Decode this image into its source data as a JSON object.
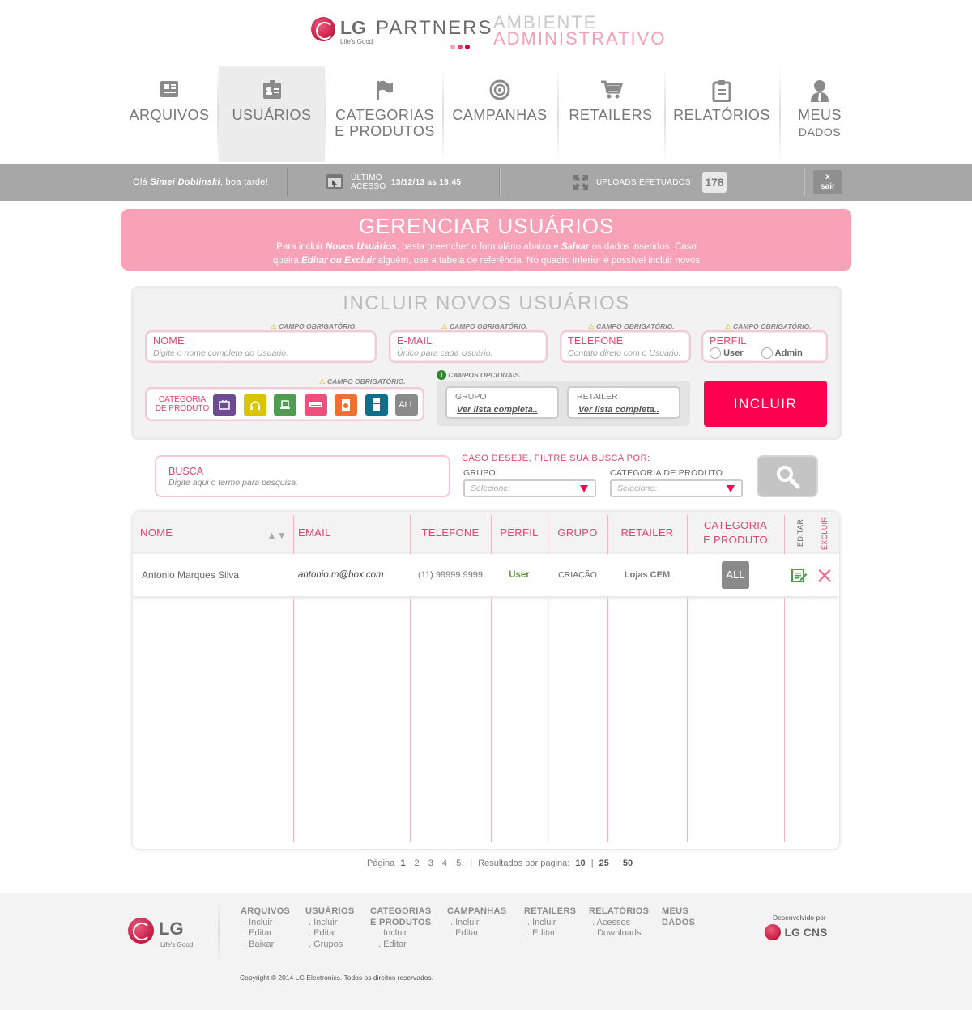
{
  "header": {
    "brand": "LG",
    "tagline": "Life's Good",
    "product": "PARTNERS",
    "env_line1": "AMBIENTE",
    "env_line2": "ADMINISTRATIVO"
  },
  "nav": {
    "items": [
      {
        "label": "ARQUIVOS",
        "icon": "newspaper-icon"
      },
      {
        "label": "USUÁRIOS",
        "icon": "id-card-icon",
        "active": true
      },
      {
        "label": "CATEGORIAS",
        "label2": "E PRODUTOS",
        "icon": "flag-icon"
      },
      {
        "label": "CAMPANHAS",
        "icon": "target-icon"
      },
      {
        "label": "RETAILERS",
        "icon": "cart-icon"
      },
      {
        "label": "RELATÓRIOS",
        "icon": "clipboard-icon"
      },
      {
        "label": "MEUS",
        "label2": "DADOS",
        "icon": "user-icon"
      }
    ]
  },
  "status": {
    "greeting_prefix": "Olá",
    "user_name": "Simei Doblinski",
    "greeting_suffix": ", boa tarde!",
    "last_access_label1": "ÚLTIMO",
    "last_access_label2": "ACESSO",
    "last_access_value": "13/12/13 as 13:45",
    "uploads_label": "UPLOADS EFETUADOS",
    "uploads_count": "178",
    "logout_x": "x",
    "logout_label": "sair"
  },
  "banner": {
    "title": "GERENCIAR USUÁRIOS",
    "t1": "Para incluir ",
    "b1": "Novos Usuários",
    "t2": ", basta preencher o formulário abaixo e ",
    "b2": "Salvar",
    "t3": " os dados inseridos. Caso queira ",
    "b3": "Editar ou Excluir",
    "t4": " alguém, use a tabela de referência. No quadro inferior é possível incluir novos ",
    "b4": "Grupos",
    "t5": " e editar os existentes."
  },
  "form": {
    "title": "INCLUIR NOVOS USUÁRIOS",
    "required": "CAMPO OBRIGATÓRIO.",
    "optional": "CAMPOS OPCIONAIS.",
    "nome_label": "NOME",
    "nome_placeholder": "Digite o nome completo do Usuário.",
    "email_label": "E-MAIL",
    "email_placeholder": "Único para cada Usuário.",
    "telefone_label": "TELEFONE",
    "telefone_placeholder": "Contato direto com o Usuário.",
    "perfil_label": "PERFIL",
    "perfil_user": "User",
    "perfil_admin": "Admin",
    "categoria_label1": "CATEGORIA",
    "categoria_label2": "DE PRODUTO",
    "categories": [
      {
        "icon": "tv-icon",
        "color": "#6c4a94"
      },
      {
        "icon": "headphones-icon",
        "color": "#d8c400"
      },
      {
        "icon": "laptop-icon",
        "color": "#4f9b4f"
      },
      {
        "icon": "air-conditioner-icon",
        "color": "#ee4f7d"
      },
      {
        "icon": "washer-icon",
        "color": "#f07032"
      },
      {
        "icon": "refrigerator-icon",
        "color": "#0f6e8c"
      }
    ],
    "categoria_all": "ALL",
    "grupo_label": "GRUPO",
    "grupo_link": "Ver lista completa..",
    "retailer_label": "RETAILER",
    "retailer_link": "Ver lista completa..",
    "submit": "INCLUIR"
  },
  "search": {
    "label": "BUSCA",
    "placeholder": "Digite aqui o termo para pesquisa.",
    "filter_title": "CASO DESEJE, FILTRE SUA BUSCA POR:",
    "grupo_label": "GRUPO",
    "grupo_value": "Selecione:",
    "categoria_label": "CATEGORIA DE PRODUTO",
    "categoria_value": "Selecione:"
  },
  "table": {
    "headers": {
      "nome": "NOME",
      "email": "EMAIL",
      "telefone": "TELEFONE",
      "perfil": "PERFIL",
      "grupo": "GRUPO",
      "retailer": "RETAILER",
      "categoria1": "CATEGORIA",
      "categoria2": "E PRODUTO",
      "editar": "EDITAR",
      "excluir": "EXCLUIR"
    },
    "rows": [
      {
        "nome": "Antonio Marques Silva",
        "email": "antonio.m@box.com",
        "telefone": "(11) 99999.9999",
        "perfil": "User",
        "grupo": "CRIAÇÃO",
        "retailer": "Lojas CEM",
        "categoria": "ALL"
      }
    ]
  },
  "pagination": {
    "label": "Página",
    "current": "1",
    "pages": [
      "2",
      "3",
      "4",
      "5"
    ],
    "sep": "|",
    "per_page_label": "Resultados por pagina:",
    "per_page_current": "10",
    "per_page_options": [
      "25",
      "50"
    ]
  },
  "footer": {
    "brand": "LG",
    "tagline": "Life's Good",
    "columns": [
      {
        "h1": "ARQUIVOS",
        "h2": "",
        "links": [
          ". Incluir",
          ". Editar",
          ". Baixar"
        ]
      },
      {
        "h1": "USUÁRIOS",
        "h2": "",
        "links": [
          ". Incluir",
          ". Editar",
          ". Grupos"
        ]
      },
      {
        "h1": "CATEGORIAS",
        "h2": "E PRODUTOS",
        "links": [
          ". Incluir",
          ". Editar"
        ]
      },
      {
        "h1": "CAMPANHAS",
        "h2": "",
        "links": [
          ". Incluir",
          ". Editar"
        ]
      },
      {
        "h1": "RETAILERS",
        "h2": "",
        "links": [
          ". Incluir",
          ". Editar"
        ]
      },
      {
        "h1": "RELATÓRIOS",
        "h2": "",
        "links": [
          ". Acessos",
          ". Downloads"
        ]
      },
      {
        "h1": "MEUS",
        "h2": "DADOS",
        "links": []
      }
    ],
    "dev_by": "Desenvolvido por",
    "dev_brand": "LG CNS",
    "copyright": "Copyright © 2014 LG Electronics. Todos os direitos reservados."
  },
  "colors": {
    "accent": "#ff0050",
    "pink_label": "#e8436c",
    "banner": "#f8a1b7",
    "bar": "#a7a7a7"
  }
}
